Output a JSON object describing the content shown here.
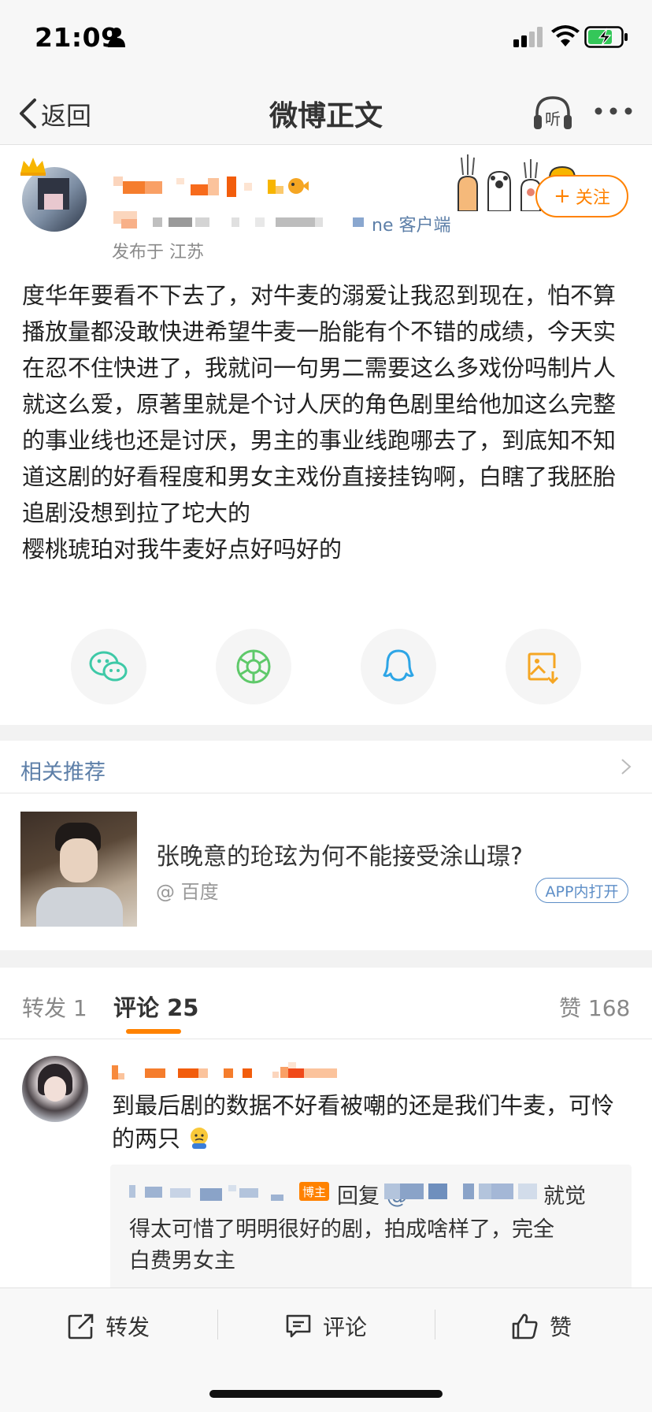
{
  "status_bar": {
    "time": "21:09"
  },
  "nav": {
    "back_label": "返回",
    "title": "微博正文",
    "listen_label": "听"
  },
  "post": {
    "source_suffix": "ne 客户端",
    "publish_info": "发布于 江苏",
    "follow_label": "关注",
    "body": "度华年要看不下去了，对牛麦的溺爱让我忍到现在，怕不算播放量都没敢快进希望牛麦一胎能有个不错的成绩，今天实在忍不住快进了，我就问一句男二需要这么多戏份吗制片人就这么爱，原著里就是个讨人厌的角色剧里给他加这么完整的事业线也还是讨厌，男主的事业线跑哪去了，到底知不知道这剧的好看程度和男女主戏份直接挂钩啊，白瞎了我胚胎追剧没想到拉了坨大的\n樱桃琥珀对我牛麦好点好吗好的"
  },
  "share_icons": [
    "wechat-icon",
    "moments-icon",
    "qq-icon",
    "save-image-icon"
  ],
  "related": {
    "title": "相关推荐",
    "question": "张晚意的玱玹为何不能接受涂山璟?",
    "source": "@ 百度",
    "badge": "APP内打开"
  },
  "tabs": {
    "repost": "转发 1",
    "comment": "评论 25",
    "likes": "赞 168"
  },
  "comment": {
    "text": "到最后剧的数据不好看被嘲的还是我们牛麦，可怜的两只",
    "reply": {
      "badge": "博主",
      "reply_label": "回复",
      "at": "@",
      "line1": "就觉",
      "line2": "得太可惜了明明很好的剧，拍成啥样了，完全",
      "line3": "白费男女主"
    }
  },
  "toolbar": {
    "repost": "转发",
    "comment": "评论",
    "like": "赞"
  },
  "colors": {
    "accent": "#ff8200",
    "link": "#5d7fa8",
    "bg": "#ffffff",
    "band": "#f2f2f2"
  }
}
